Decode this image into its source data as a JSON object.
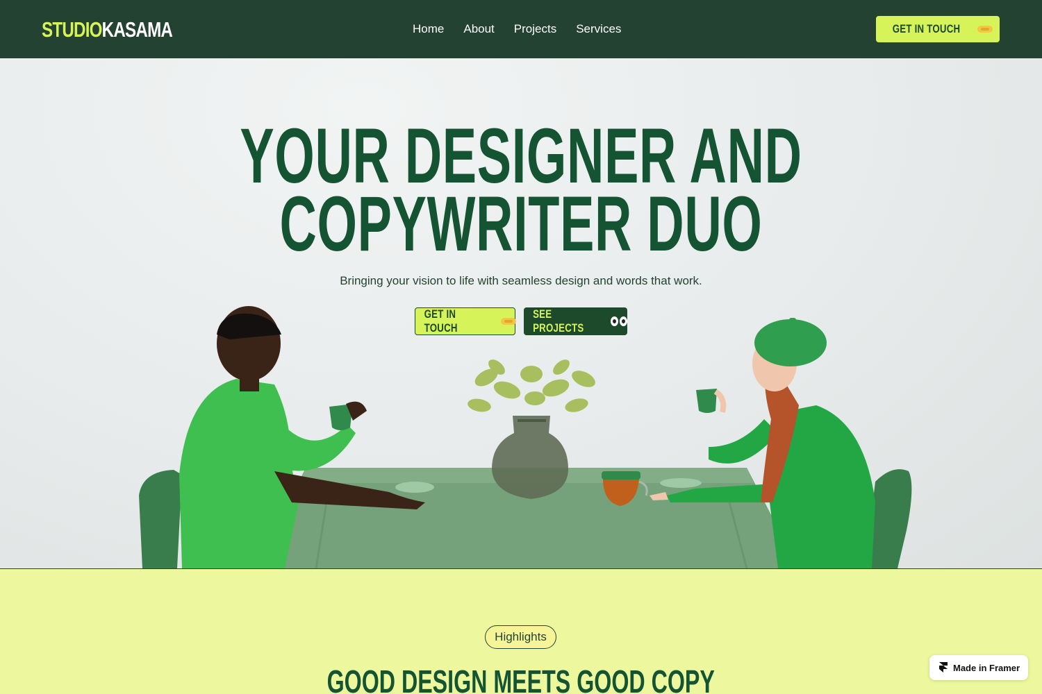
{
  "nav": {
    "logo_part1": "STUDIO",
    "logo_part2": "KASAMA",
    "links": [
      "Home",
      "About",
      "Projects",
      "Services"
    ],
    "cta_label": "GET IN TOUCH"
  },
  "hero": {
    "headline_line1": "YOUR DESIGNER AND",
    "headline_line2": "COPYWRITER DUO",
    "subtitle": "Bringing your vision to life with seamless design and words that work.",
    "primary_button": "GET IN TOUCH",
    "secondary_button": "SEE PROJECTS"
  },
  "highlights": {
    "badge": "Highlights",
    "title": "GOOD DESIGN MEETS GOOD COPY"
  },
  "framer_badge": "Made in Framer",
  "colors": {
    "nav_bg": "#244232",
    "accent_lime": "#d6f35a",
    "headline_green": "#145432",
    "section_bg": "#ecf79e"
  },
  "icons": [
    "handshake-icon",
    "eyes-icon",
    "framer-logo-icon"
  ]
}
